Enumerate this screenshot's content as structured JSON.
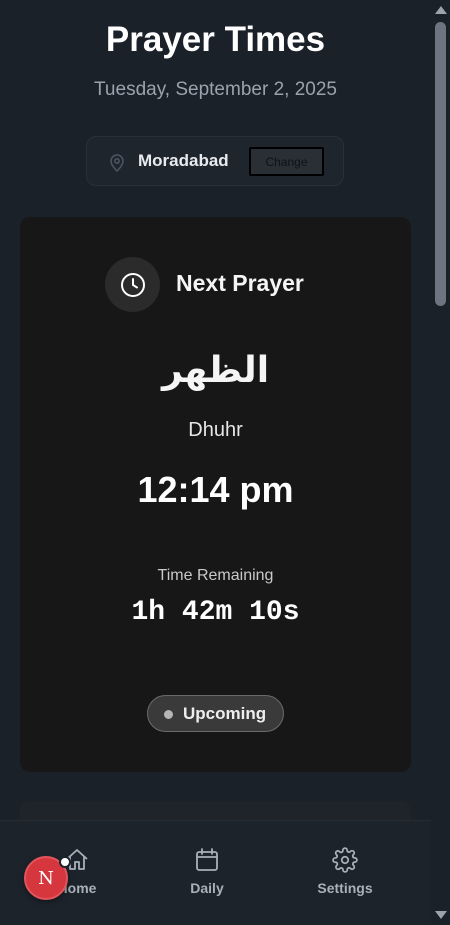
{
  "header": {
    "title": "Prayer Times",
    "date": "Tuesday, September 2, 2025"
  },
  "location": {
    "icon": "map-pin-icon",
    "name": "Moradabad",
    "change_label": "Change"
  },
  "next_prayer": {
    "heading": "Next Prayer",
    "icon": "clock-icon",
    "arabic_name": "الظهر",
    "english_name": "Dhuhr",
    "time": "12:14 pm",
    "remaining_label": "Time Remaining",
    "countdown": "1h 42m 10s",
    "status": "Upcoming"
  },
  "nav": {
    "home": {
      "label": "Home",
      "icon": "home-icon"
    },
    "daily": {
      "label": "Daily",
      "icon": "calendar-icon"
    },
    "settings": {
      "label": "Settings",
      "icon": "gear-icon"
    }
  },
  "avatar": {
    "initial": "N",
    "color": "#d6363e"
  },
  "colors": {
    "background": "#1b2129",
    "card": "#171717",
    "muted_text": "#9aa3ad"
  }
}
